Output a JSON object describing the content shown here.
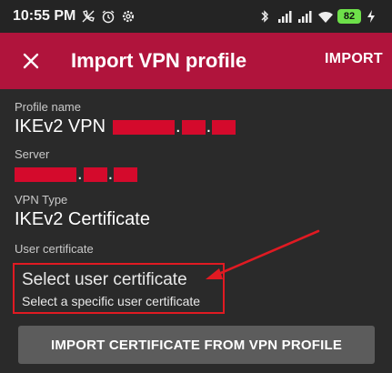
{
  "status_bar": {
    "time": "10:55 PM",
    "battery": "82",
    "battery_color": "#6ee04a",
    "icons": [
      "blocked-call-icon",
      "alarm-icon",
      "settings-icon",
      "bluetooth-icon",
      "signal-icon",
      "signal-icon",
      "wifi-icon",
      "battery-icon",
      "charging-icon"
    ]
  },
  "app_bar": {
    "title": "Import VPN profile",
    "action_label": "IMPORT",
    "close_icon": "close-icon",
    "color": "#b0143c"
  },
  "form": {
    "profile_name_label": "Profile name",
    "profile_name_value": "IKEv2 VPN",
    "server_label": "Server",
    "vpn_type_label": "VPN Type",
    "vpn_type_value": "IKEv2 Certificate",
    "user_cert_label": "User certificate",
    "select_title": "Select user certificate",
    "select_subtitle": "Select a specific user certificate"
  },
  "import_button_label": "IMPORT CERTIFICATE FROM VPN PROFILE",
  "annotation_color": "#e01a22",
  "redaction_color": "#d40a2c"
}
